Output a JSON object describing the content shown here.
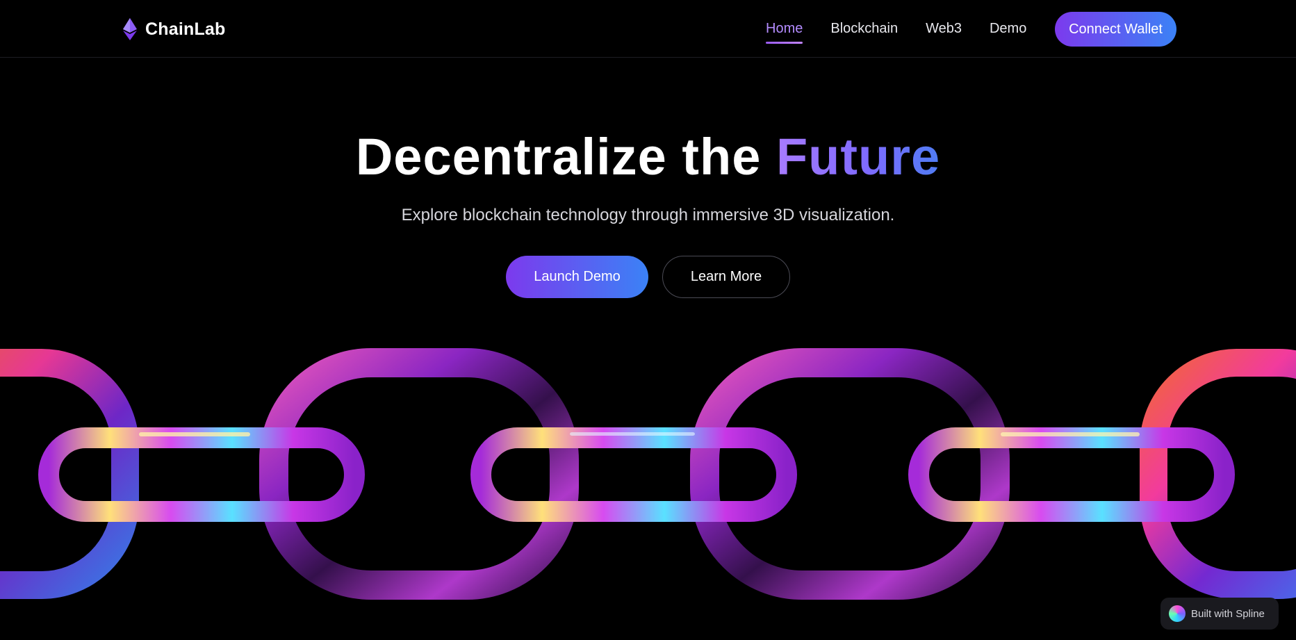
{
  "brand": {
    "name": "ChainLab",
    "logo_icon": "ethereum-diamond-icon"
  },
  "nav": {
    "items": [
      {
        "label": "Home",
        "active": true
      },
      {
        "label": "Blockchain",
        "active": false
      },
      {
        "label": "Web3",
        "active": false
      },
      {
        "label": "Demo",
        "active": false
      }
    ],
    "connect_label": "Connect Wallet"
  },
  "hero": {
    "title_main": "Decentralize the ",
    "title_accent": "Future",
    "subtitle": "Explore blockchain technology through immersive 3D visualization.",
    "primary_cta": "Launch Demo",
    "secondary_cta": "Learn More"
  },
  "badge": {
    "label": "Built with Spline"
  },
  "colors": {
    "background": "#000000",
    "accent_purple": "#7c3aed",
    "accent_blue": "#3b82f6",
    "nav_active": "#b48cff"
  }
}
